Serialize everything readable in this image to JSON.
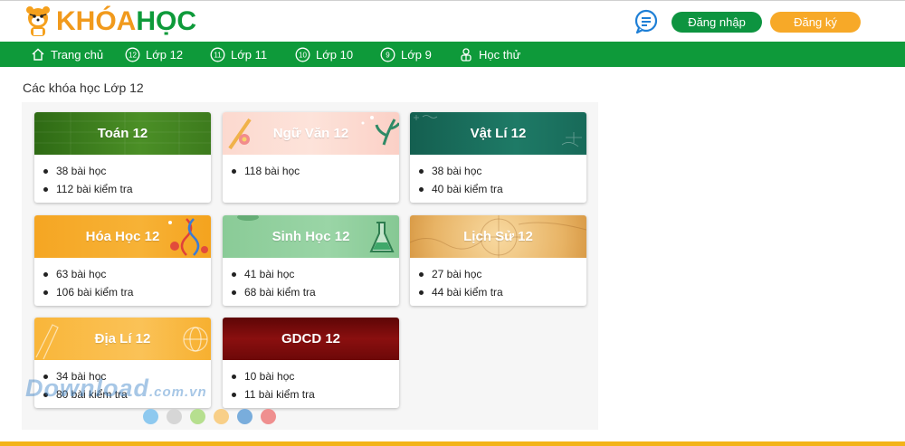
{
  "header": {
    "logo_text_1": "KHÓA",
    "logo_text_2": "HỌC",
    "login_label": "Đăng nhập",
    "register_label": "Đăng ký"
  },
  "nav": {
    "items": [
      {
        "label": "Trang chủ",
        "badge": ""
      },
      {
        "label": "Lớp 12",
        "badge": "12"
      },
      {
        "label": "Lớp 11",
        "badge": "11"
      },
      {
        "label": "Lớp 10",
        "badge": "10"
      },
      {
        "label": "Lớp 9",
        "badge": "9"
      },
      {
        "label": "Học thử",
        "badge": ""
      }
    ]
  },
  "page_title": "Các khóa học Lớp 12",
  "courses": [
    {
      "title": "Toán 12",
      "lessons": "38 bài học",
      "tests": "112 bài kiểm tra",
      "color": "#3f7d1e"
    },
    {
      "title": "Ngữ Văn 12",
      "lessons": "118 bài học",
      "tests": "",
      "color": "#fbd3cc"
    },
    {
      "title": "Vật Lí 12",
      "lessons": "38 bài học",
      "tests": "40 bài kiểm tra",
      "color": "#1b6d5e"
    },
    {
      "title": "Hóa Học 12",
      "lessons": "63 bài học",
      "tests": "106 bài kiểm tra",
      "color": "#f5a623"
    },
    {
      "title": "Sinh Học 12",
      "lessons": "41 bài học",
      "tests": "68 bài kiểm tra",
      "color": "#8fce9b"
    },
    {
      "title": "Lịch Sử 12",
      "lessons": "27 bài học",
      "tests": "44 bài kiểm tra",
      "color": "#e9b86a"
    },
    {
      "title": "Địa Lí 12",
      "lessons": "34 bài học",
      "tests": "80 bài kiểm tra",
      "color": "#f9b93a"
    },
    {
      "title": "GDCD 12",
      "lessons": "10 bài học",
      "tests": "11 bài kiểm tra",
      "color": "#7a0a0a"
    }
  ],
  "pagination_dot_colors": [
    "#8ec9ef",
    "#d6d6d6",
    "#b6df8f",
    "#f8cf88",
    "#79addc",
    "#ef8f8f"
  ],
  "watermark": {
    "text": "Download",
    "suffix": ".com.vn"
  }
}
